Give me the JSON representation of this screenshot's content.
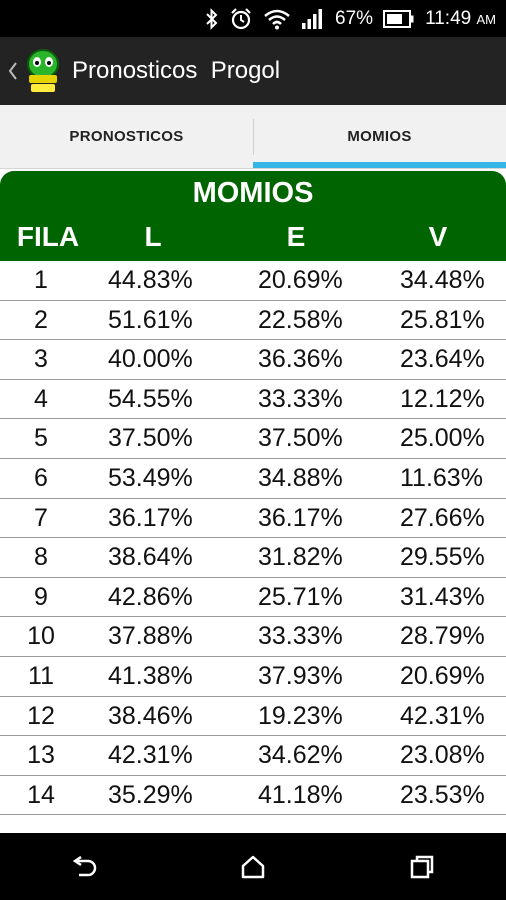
{
  "status_bar": {
    "battery_percent": "67%",
    "time": "11:49",
    "time_suffix": "AM",
    "icons": [
      "bluetooth-icon",
      "alarm-icon",
      "wifi-icon",
      "signal-icon",
      "battery-icon"
    ]
  },
  "action_bar": {
    "title": "Pronosticos  Progol",
    "logo_text": "Progol MX"
  },
  "tabs": [
    {
      "label": "PRONOSTICOS",
      "active": false
    },
    {
      "label": "MOMIOS",
      "active": true
    }
  ],
  "table": {
    "title": "MOMIOS",
    "headers": {
      "fila": "FILA",
      "l": "L",
      "e": "E",
      "v": "V"
    },
    "rows": [
      {
        "fila": "1",
        "l": "44.83%",
        "e": "20.69%",
        "v": "34.48%"
      },
      {
        "fila": "2",
        "l": "51.61%",
        "e": "22.58%",
        "v": "25.81%"
      },
      {
        "fila": "3",
        "l": "40.00%",
        "e": "36.36%",
        "v": "23.64%"
      },
      {
        "fila": "4",
        "l": "54.55%",
        "e": "33.33%",
        "v": "12.12%"
      },
      {
        "fila": "5",
        "l": "37.50%",
        "e": "37.50%",
        "v": "25.00%"
      },
      {
        "fila": "6",
        "l": "53.49%",
        "e": "34.88%",
        "v": "11.63%"
      },
      {
        "fila": "7",
        "l": "36.17%",
        "e": "36.17%",
        "v": "27.66%"
      },
      {
        "fila": "8",
        "l": "38.64%",
        "e": "31.82%",
        "v": "29.55%"
      },
      {
        "fila": "9",
        "l": "42.86%",
        "e": "25.71%",
        "v": "31.43%"
      },
      {
        "fila": "10",
        "l": "37.88%",
        "e": "33.33%",
        "v": "28.79%"
      },
      {
        "fila": "11",
        "l": "41.38%",
        "e": "37.93%",
        "v": "20.69%"
      },
      {
        "fila": "12",
        "l": "38.46%",
        "e": "19.23%",
        "v": "42.31%"
      },
      {
        "fila": "13",
        "l": "42.31%",
        "e": "34.62%",
        "v": "23.08%"
      },
      {
        "fila": "14",
        "l": "35.29%",
        "e": "41.18%",
        "v": "23.53%"
      }
    ]
  },
  "colors": {
    "header_green": "#006400",
    "tab_indicator": "#33b5e5",
    "action_bar": "#232323"
  },
  "nav_bar": {
    "buttons": [
      "back-nav-icon",
      "home-nav-icon",
      "recents-nav-icon"
    ]
  }
}
